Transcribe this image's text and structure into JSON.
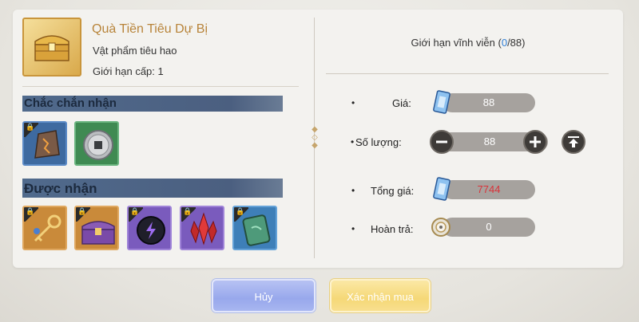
{
  "item": {
    "name": "Quà Tiền Tiêu Dự Bị",
    "type": "Vật phẩm tiêu hao",
    "level_limit": "Giới hạn cấp: 1",
    "icon": "golden-chest-icon"
  },
  "sections": {
    "guaranteed": {
      "title": "Chắc chắn nhận",
      "items": [
        "rune-stone-icon",
        "silver-coin-icon"
      ]
    },
    "possible": {
      "title": "Được nhận",
      "items": [
        "golden-key-icon",
        "purple-chest-icon",
        "purple-orb-icon",
        "red-crystal-icon",
        "jade-tablet-icon"
      ]
    }
  },
  "purchase": {
    "limit_prefix": "Giới hạn vĩnh viễn (",
    "limit_current": "0",
    "limit_suffix": "/88)",
    "price_label": "Giá:",
    "price_value": "88",
    "quantity_label": "Số lượng:",
    "quantity_value": "88",
    "total_label": "Tổng giá:",
    "total_value": "7744",
    "refund_label": "Hoàn trả:",
    "refund_value": "0",
    "bullet": "•"
  },
  "buttons": {
    "cancel": "Hủy",
    "confirm": "Xác nhận mua"
  },
  "colors": {
    "title": "#b8843a",
    "accent_blue": "#2f7fd6",
    "total_red": "#d9333a",
    "section_bar": "#506a8c"
  }
}
